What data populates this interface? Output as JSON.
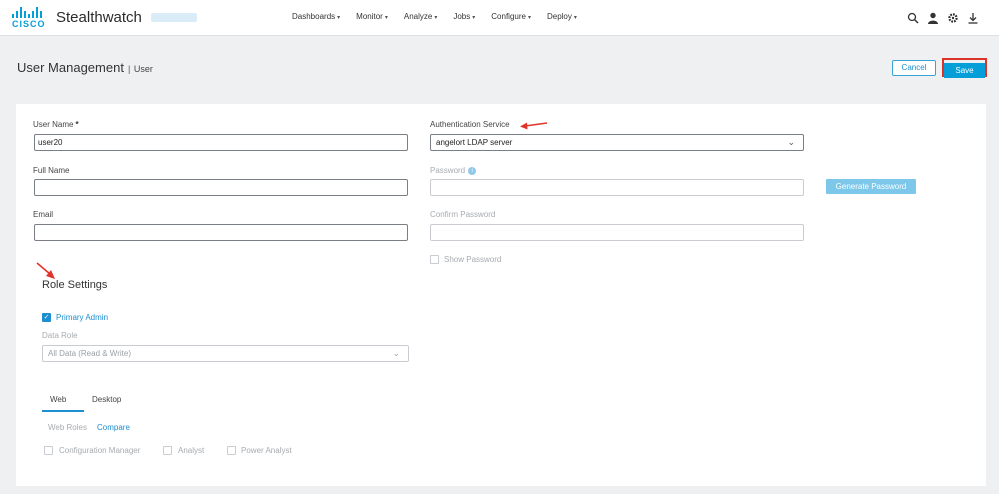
{
  "brand": {
    "product": "Stealthwatch",
    "logo_text": "CISCO",
    "accent": "#049fd9"
  },
  "nav": {
    "items": [
      {
        "label": "Dashboards",
        "caret": "▾"
      },
      {
        "label": "Monitor",
        "caret": "▾"
      },
      {
        "label": "Analyze",
        "caret": "▾"
      },
      {
        "label": "Jobs",
        "caret": "▾"
      },
      {
        "label": "Configure",
        "caret": "▾"
      },
      {
        "label": "Deploy",
        "caret": "▾"
      }
    ],
    "icons": [
      "search-icon",
      "user-icon",
      "gear-icon",
      "download-icon"
    ]
  },
  "header": {
    "title": "User Management",
    "separator": "|",
    "subtitle": "User",
    "cancel_label": "Cancel",
    "save_label": "Save"
  },
  "form": {
    "user_name_label": "User Name",
    "required_marker": "*",
    "user_name_value": "user20",
    "full_name_label": "Full Name",
    "full_name_value": "",
    "email_label": "Email",
    "email_value": "",
    "auth_label": "Authentication Service",
    "auth_value": "angelort LDAP server",
    "password_label": "Password",
    "password_info": "i",
    "generate_label": "Generate Password",
    "confirm_label": "Confirm Password",
    "show_password_label": "Show Password"
  },
  "roles": {
    "title": "Role Settings",
    "primary_admin_label": "Primary Admin",
    "primary_admin_checked": true,
    "data_role_label": "Data Role",
    "data_role_value": "All Data (Read & Write)",
    "tabs": [
      "Web",
      "Desktop"
    ],
    "active_tab": "Web",
    "web_roles_label": "Web Roles",
    "compare_label": "Compare",
    "web_role_options": [
      "Configuration Manager",
      "Analyst",
      "Power Analyst"
    ]
  }
}
